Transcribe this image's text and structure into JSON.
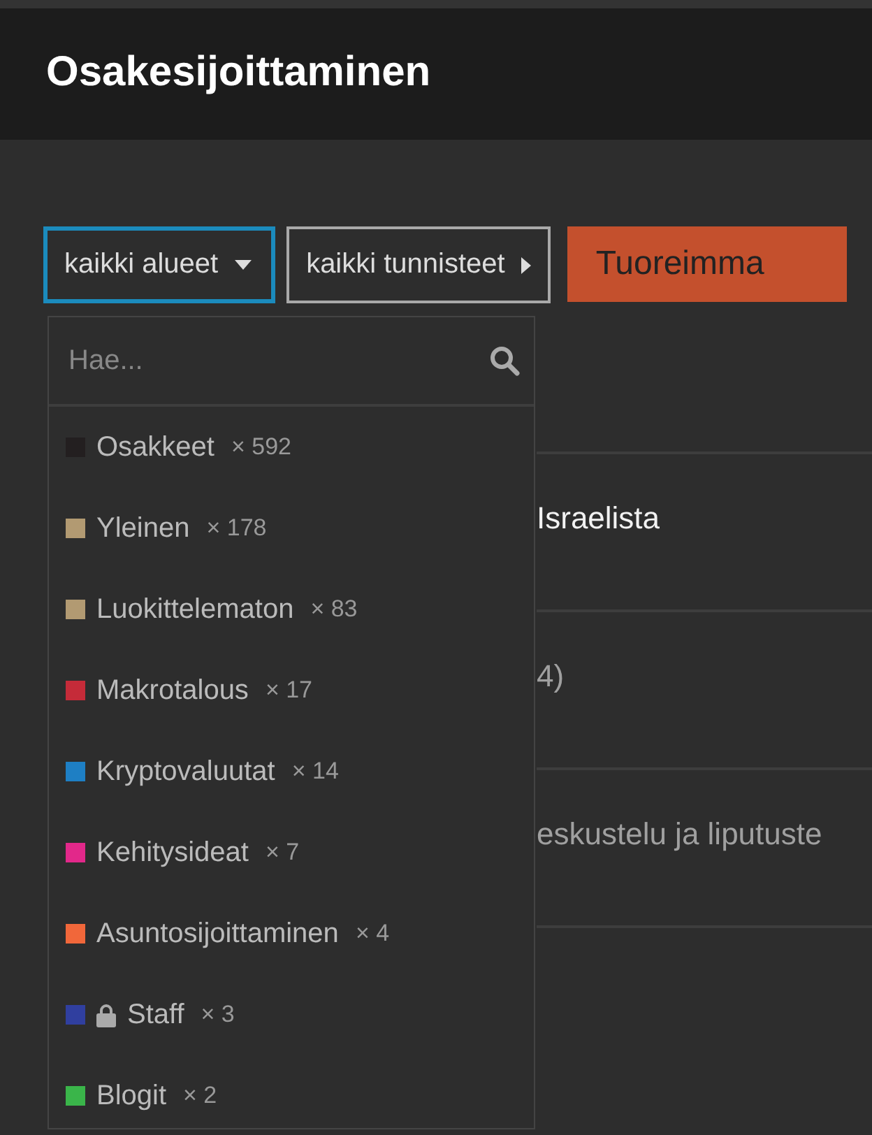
{
  "header": {
    "title": "Osakesijoittaminen"
  },
  "filters": [
    {
      "label": "kaikki alueet",
      "kind": "dropdown",
      "expanded": true
    },
    {
      "label": "kaikki tunnisteet",
      "kind": "dropdown",
      "expanded": false
    },
    {
      "label": "Tuoreimma",
      "kind": "tab"
    }
  ],
  "dropdown": {
    "search": {
      "placeholder": "Hae..."
    },
    "items": [
      {
        "name": "Osakkeet",
        "count": "× 592",
        "color": "#231f20",
        "locked": false
      },
      {
        "name": "Yleinen",
        "count": "× 178",
        "color": "#b29a72",
        "locked": false
      },
      {
        "name": "Luokittelematon",
        "count": "× 83",
        "color": "#b29a72",
        "locked": false
      },
      {
        "name": "Makrotalous",
        "count": "× 17",
        "color": "#c52b39",
        "locked": false
      },
      {
        "name": "Kryptovaluutat",
        "count": "× 14",
        "color": "#1e7fc4",
        "locked": false
      },
      {
        "name": "Kehitysideat",
        "count": "× 7",
        "color": "#e2288a",
        "locked": false
      },
      {
        "name": "Asuntosijoittaminen",
        "count": "× 4",
        "color": "#f1673a",
        "locked": false
      },
      {
        "name": "Staff",
        "count": "× 3",
        "color": "#303f9f",
        "locked": true
      },
      {
        "name": "Blogit",
        "count": "× 2",
        "color": "#3ab54a",
        "locked": false
      }
    ]
  },
  "topics": [
    {
      "title": "Israelista",
      "unread": true
    },
    {
      "title": "4)",
      "unread": false
    },
    {
      "title": "eskustelu ja liputuste",
      "unread": false
    }
  ]
}
